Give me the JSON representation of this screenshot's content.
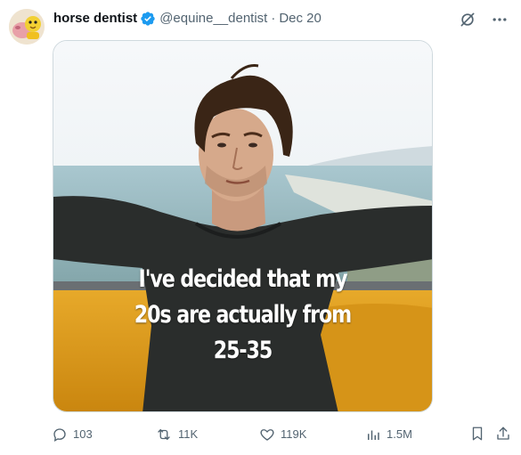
{
  "author": {
    "display_name": "horse dentist",
    "handle": "@equine__dentist",
    "separator": "·",
    "date": "Dec 20"
  },
  "media": {
    "caption_lines": [
      "I've decided that my",
      "20s are actually from",
      "25-35"
    ]
  },
  "actions": {
    "replies": "103",
    "reposts": "11K",
    "likes": "119K",
    "views": "1.5M"
  },
  "colors": {
    "verified": "#1d9bf0",
    "secondary_text": "#536471",
    "primary_text": "#0f1419"
  }
}
